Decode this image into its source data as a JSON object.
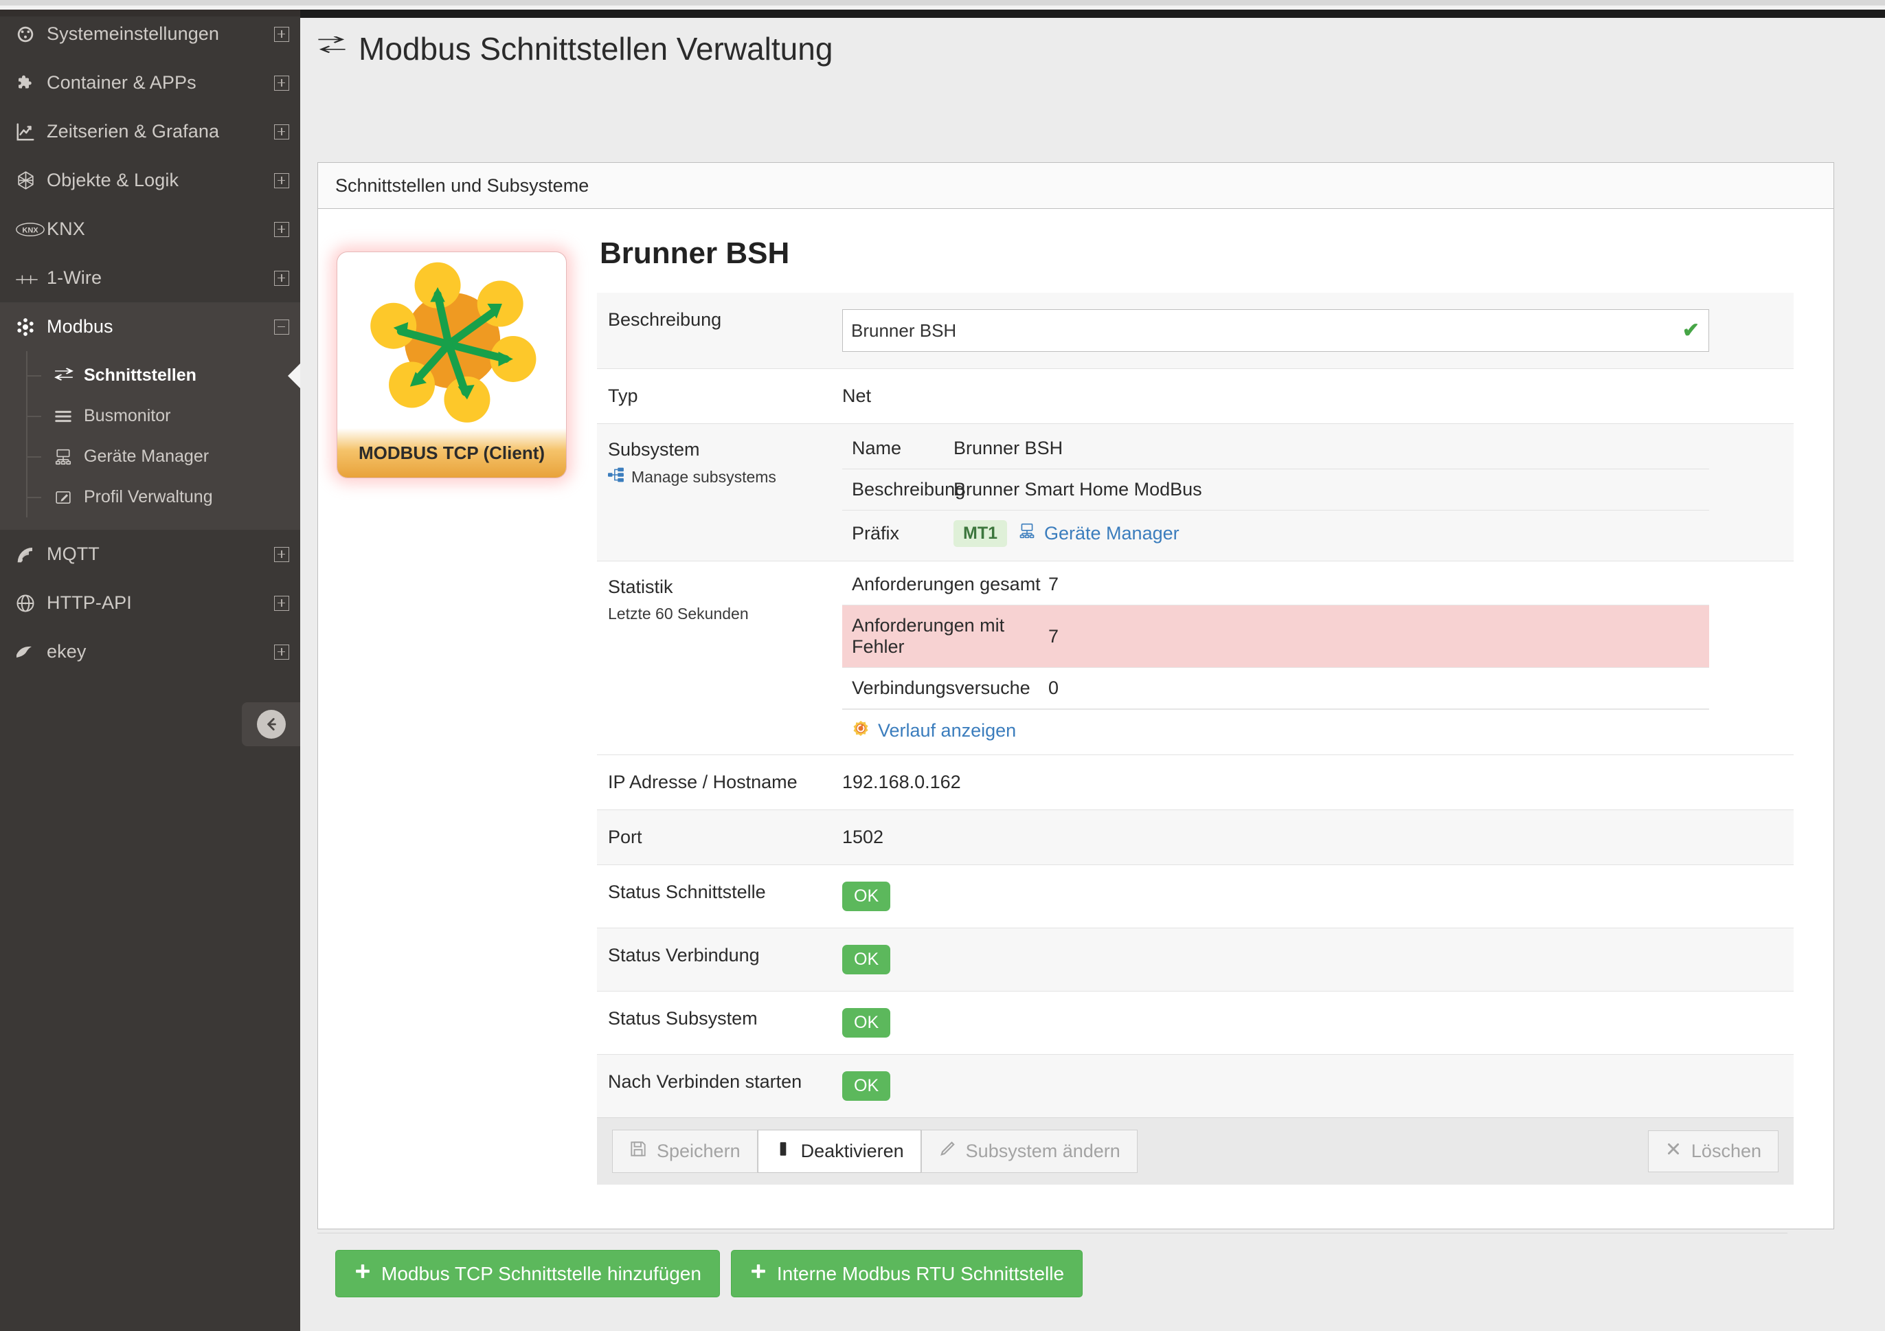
{
  "sidebar": {
    "items": [
      {
        "label": "Systemeinstellungen",
        "icon": "dashboard-icon",
        "expander": "plus"
      },
      {
        "label": "Container & APPs",
        "icon": "puzzle-icon",
        "expander": "plus"
      },
      {
        "label": "Zeitserien & Grafana",
        "icon": "chart-icon",
        "expander": "plus"
      },
      {
        "label": "Objekte & Logik",
        "icon": "hexagon-network-icon",
        "expander": "plus"
      },
      {
        "label": "KNX",
        "icon": "knx-icon",
        "expander": "plus"
      },
      {
        "label": "1-Wire",
        "icon": "onewire-icon",
        "expander": "plus"
      },
      {
        "label": "Modbus",
        "icon": "modbus-nodes-icon",
        "expander": "minus"
      }
    ],
    "submenu": [
      {
        "label": "Schnittstellen",
        "icon": "exchange-arrows-icon",
        "active": true
      },
      {
        "label": "Busmonitor",
        "icon": "list-lines-icon",
        "active": false
      },
      {
        "label": "Geräte Manager",
        "icon": "device-network-icon",
        "active": false
      },
      {
        "label": "Profil Verwaltung",
        "icon": "edit-pencil-icon",
        "active": false
      }
    ],
    "items_after": [
      {
        "label": "MQTT",
        "icon": "rss-icon",
        "expander": "plus"
      },
      {
        "label": "HTTP-API",
        "icon": "globe-api-icon",
        "expander": "plus"
      },
      {
        "label": "ekey",
        "icon": "finger-scan-icon",
        "expander": "plus"
      }
    ],
    "collapse_icon": "arrow-left-circle-icon"
  },
  "header": {
    "title": "Modbus Schnittstellen Verwaltung",
    "title_icon": "exchange-arrows-icon"
  },
  "panel": {
    "head": "Schnittstellen und Subsysteme"
  },
  "tile": {
    "caption": "MODBUS TCP (Client)",
    "icon": "modbus-tcp-client-icon"
  },
  "form": {
    "title": "Brunner BSH",
    "description_label": "Beschreibung",
    "description_value": "Brunner BSH",
    "description_placeholder": "Beschreibung",
    "description_valid_icon": "check-icon",
    "type_label": "Typ",
    "type_value": "Net",
    "subsystem_label": "Subsystem",
    "subsystem_manage_link": "Manage subsystems",
    "subsystem_manage_icon": "sitemap-icon",
    "subsystem_rows": [
      {
        "key": "Name",
        "value": "Brunner BSH"
      },
      {
        "key": "Beschreibung",
        "value": "Brunner Smart Home ModBus"
      }
    ],
    "prefix_key": "Präfix",
    "prefix_badge": "MT1",
    "prefix_link": "Geräte Manager",
    "prefix_link_icon": "device-network-icon",
    "statistics_label": "Statistik",
    "statistics_sublabel": "Letzte 60 Sekunden",
    "statistics_rows": [
      {
        "name": "Anforderungen gesamt",
        "value": "7",
        "error": false
      },
      {
        "name": "Anforderungen mit Fehler",
        "value": "7",
        "error": true
      },
      {
        "name": "Verbindungsversuche",
        "value": "0",
        "error": false
      }
    ],
    "history_link": "Verlauf anzeigen",
    "history_link_icon": "history-clock-icon",
    "ip_label": "IP Adresse / Hostname",
    "ip_value": "192.168.0.162",
    "port_label": "Port",
    "port_value": "1502",
    "status_rows": [
      {
        "label": "Status Schnittstelle",
        "badge": "OK"
      },
      {
        "label": "Status Verbindung",
        "badge": "OK"
      },
      {
        "label": "Status Subsystem",
        "badge": "OK"
      },
      {
        "label": "Nach Verbinden starten",
        "badge": "OK"
      }
    ]
  },
  "buttons": {
    "save": "Speichern",
    "save_icon": "save-icon",
    "deactivate": "Deaktivieren",
    "deactivate_icon": "stop-square-icon",
    "change_subsystem": "Subsystem ändern",
    "change_subsystem_icon": "pencil-icon",
    "delete": "Löschen",
    "delete_icon": "x-icon",
    "add_tcp": "Modbus TCP Schnittstelle hinzufügen",
    "add_rtu": "Interne Modbus RTU Schnittstelle",
    "add_icon": "plus-icon"
  },
  "colors": {
    "sidebar_bg": "#3b3836",
    "sidebar_open_bg": "#464240",
    "accent_link": "#3b7dbd",
    "success": "#5cb85c",
    "prefix_badge_bg": "#dff0d8",
    "prefix_badge_fg": "#3c763d",
    "error_row_bg": "#f7d2d2",
    "tile_glow": "#ff9696"
  }
}
